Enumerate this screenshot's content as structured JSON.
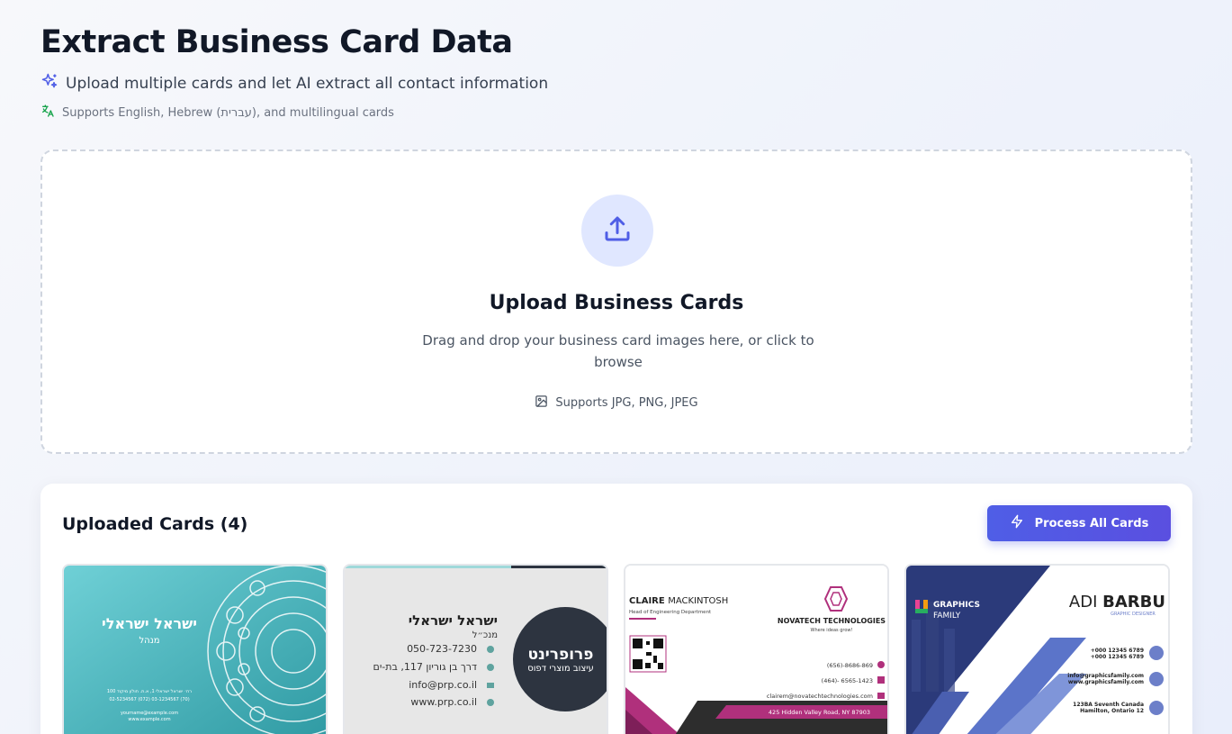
{
  "header": {
    "title": "Extract Business Card Data",
    "subtitle": "Upload multiple cards and let AI extract all contact information",
    "languages_note": "Supports English, Hebrew (עברית), and multilingual cards"
  },
  "upload": {
    "title": "Upload Business Cards",
    "description": "Drag and drop your business card images here, or click to browse",
    "formats": "Supports JPG, PNG, JPEG"
  },
  "uploaded": {
    "title": "Uploaded Cards (4)",
    "process_button": "Process All Cards"
  },
  "cards": [
    {
      "name": "ישראל ישראלי",
      "role": "מנהל",
      "address": "רח׳ ישראל ישראלי 1, א.ת. חולון מיקוד 100",
      "phones": "02-5234567 (072) 03-1234567 (70)",
      "email": "yourname@example.com",
      "web": "www.example.com"
    },
    {
      "name": "ישראל ישראלי",
      "role": "מנכ״ל",
      "phone": "050-723-7230",
      "address": "דרך בן גוריון 117, בת-ים",
      "email": "info@prp.co.il",
      "web": "www.prp.co.il",
      "logo": "פרופרינט",
      "tagline": "עיצוב מוצרי דפוס"
    },
    {
      "name_first": "CLAIRE",
      "name_last": "MACKINTOSH",
      "role": "Head of Engineering Department",
      "company": "NOVATECH TECHNOLOGIES",
      "slogan": "Where ideas grow!",
      "phone1": "(656)-8686-869",
      "phone2": "(464)- 6565-1423",
      "email": "clairem@novatechtechnologies.com",
      "address": "425 Hidden Valley Road, NY 87903"
    },
    {
      "brand1": "GRAPHICS",
      "brand2": "FAMILY",
      "name_first": "ADI",
      "name_last": "BARBU",
      "role": "GRAPHIC DESIGNER",
      "phone1": "+000 12345 6789",
      "phone2": "+000 12345 6789",
      "email": "info@graphicsfamily.com",
      "web": "www.graphicsfamily.com",
      "address1": "123BA Seventh Canada",
      "address2": "Hamilton, Ontario 12"
    }
  ]
}
